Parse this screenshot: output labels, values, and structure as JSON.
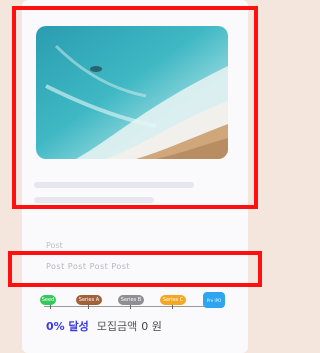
{
  "hero": {
    "alt": "aerial beach waves"
  },
  "meta": {
    "small_label": "Post",
    "title": "Post Post Post Post"
  },
  "steps": [
    {
      "label": "Seed",
      "color": "#34c759"
    },
    {
      "label": "Series A",
      "color": "#a0613b"
    },
    {
      "label": "Series B",
      "color": "#8e8e93"
    },
    {
      "label": "Series C",
      "color": "#f5a623"
    }
  ],
  "end_button": {
    "label": "Pre IPO"
  },
  "stats": {
    "percent": "0% 달성",
    "amount_label": "모집금액",
    "amount_value": "0 원"
  }
}
